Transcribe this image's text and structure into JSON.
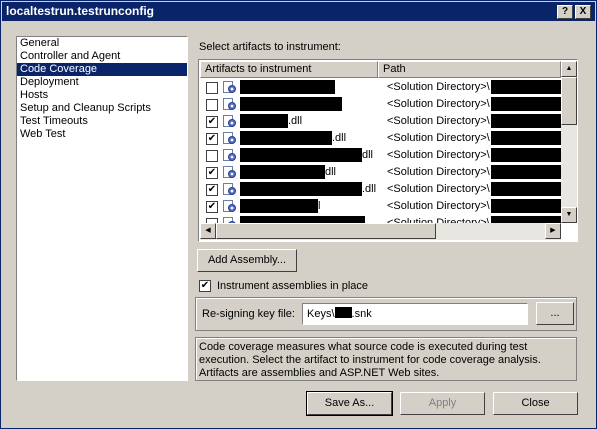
{
  "window": {
    "title": "localtestrun.testrunconfig"
  },
  "title_buttons": {
    "help": "?",
    "close": "X"
  },
  "nav": {
    "items": [
      {
        "label": "General",
        "selected": false
      },
      {
        "label": "Controller and Agent",
        "selected": false
      },
      {
        "label": "Code Coverage",
        "selected": true
      },
      {
        "label": "Deployment",
        "selected": false
      },
      {
        "label": "Hosts",
        "selected": false
      },
      {
        "label": "Setup and Cleanup Scripts",
        "selected": false
      },
      {
        "label": "Test Timeouts",
        "selected": false
      },
      {
        "label": "Web Test",
        "selected": false
      }
    ]
  },
  "artifacts": {
    "heading": "Select artifacts to instrument:",
    "columns": {
      "artifacts": "Artifacts to instrument",
      "path": "Path"
    },
    "rows": [
      {
        "checked": false,
        "suffix": "",
        "path": "<Solution Directory>\\"
      },
      {
        "checked": false,
        "suffix": "",
        "path": "<Solution Directory>\\"
      },
      {
        "checked": true,
        "suffix": ".dll",
        "path": "<Solution Directory>\\"
      },
      {
        "checked": true,
        "suffix": ".dll",
        "path": "<Solution Directory>\\"
      },
      {
        "checked": false,
        "suffix": "dll",
        "path": "<Solution Directory>\\"
      },
      {
        "checked": true,
        "suffix": "dll",
        "path": "<Solution Directory>\\"
      },
      {
        "checked": true,
        "suffix": ".dll",
        "path": "<Solution Directory>\\"
      },
      {
        "checked": true,
        "suffix": "l",
        "path": "<Solution Directory>\\"
      },
      {
        "checked": false,
        "suffix": "",
        "path": "<Solution Directory>\\"
      }
    ]
  },
  "add_assembly_label": "Add Assembly...",
  "instrument_in_place": {
    "label": "Instrument assemblies in place",
    "checked": true
  },
  "resign": {
    "label": "Re-signing key file:",
    "value_prefix": "Keys\\",
    "value_suffix": ".snk",
    "browse_label": "..."
  },
  "description": "Code coverage measures what source code is executed during test execution. Select the artifact to instrument for code coverage analysis. Artifacts are assemblies and ASP.NET Web sites.",
  "footer": {
    "save_as": "Save As...",
    "apply": "Apply",
    "close": "Close"
  },
  "colors": {
    "titlebar": "#0a246a",
    "selection": "#0a246a",
    "face": "#d4d0c8"
  }
}
